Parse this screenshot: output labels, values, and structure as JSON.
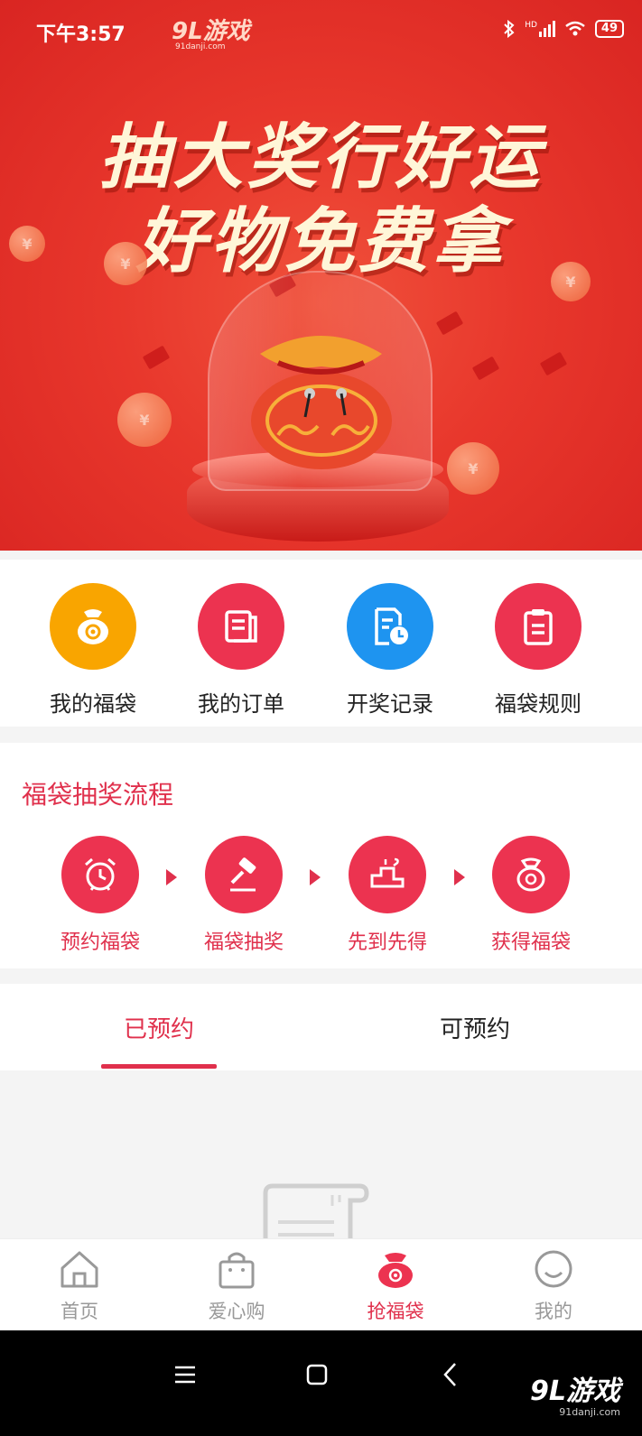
{
  "status_bar": {
    "time": "下午3:57",
    "logo": "9L游戏",
    "logo_sub": "91danji.com",
    "network": "HD",
    "battery": "49"
  },
  "banner": {
    "line1": "抽大奖行好运",
    "line2": "好物免费拿",
    "coin_symbol": "¥"
  },
  "quick_menu": [
    {
      "label": "我的福袋",
      "icon": "lucky-bag-icon",
      "color": "#f9a500"
    },
    {
      "label": "我的订单",
      "icon": "order-list-icon",
      "color": "#ec3350"
    },
    {
      "label": "开奖记录",
      "icon": "record-clock-icon",
      "color": "#1e94f0"
    },
    {
      "label": "福袋规则",
      "icon": "clipboard-icon",
      "color": "#ec3350"
    }
  ],
  "process": {
    "title": "福袋抽奖流程",
    "steps": [
      {
        "label": "预约福袋",
        "icon": "alarm-clock-icon"
      },
      {
        "label": "福袋抽奖",
        "icon": "gavel-icon"
      },
      {
        "label": "先到先得",
        "icon": "podium-icon"
      },
      {
        "label": "获得福袋",
        "icon": "lucky-bag-icon"
      }
    ]
  },
  "tabs": [
    {
      "label": "已预约",
      "active": true
    },
    {
      "label": "可预约",
      "active": false
    }
  ],
  "bottom_nav": [
    {
      "label": "首页",
      "icon": "home-icon",
      "active": false
    },
    {
      "label": "爱心购",
      "icon": "shopping-bag-icon",
      "active": false
    },
    {
      "label": "抢福袋",
      "icon": "lucky-bag-icon",
      "active": true
    },
    {
      "label": "我的",
      "icon": "smiley-face-icon",
      "active": false
    }
  ],
  "watermark": {
    "text": "9L游戏",
    "sub": "91danji.com"
  },
  "colors": {
    "brand_red": "#e0304c",
    "banner_red": "#e8372c",
    "gold": "#f9a500",
    "blue": "#1e94f0"
  }
}
